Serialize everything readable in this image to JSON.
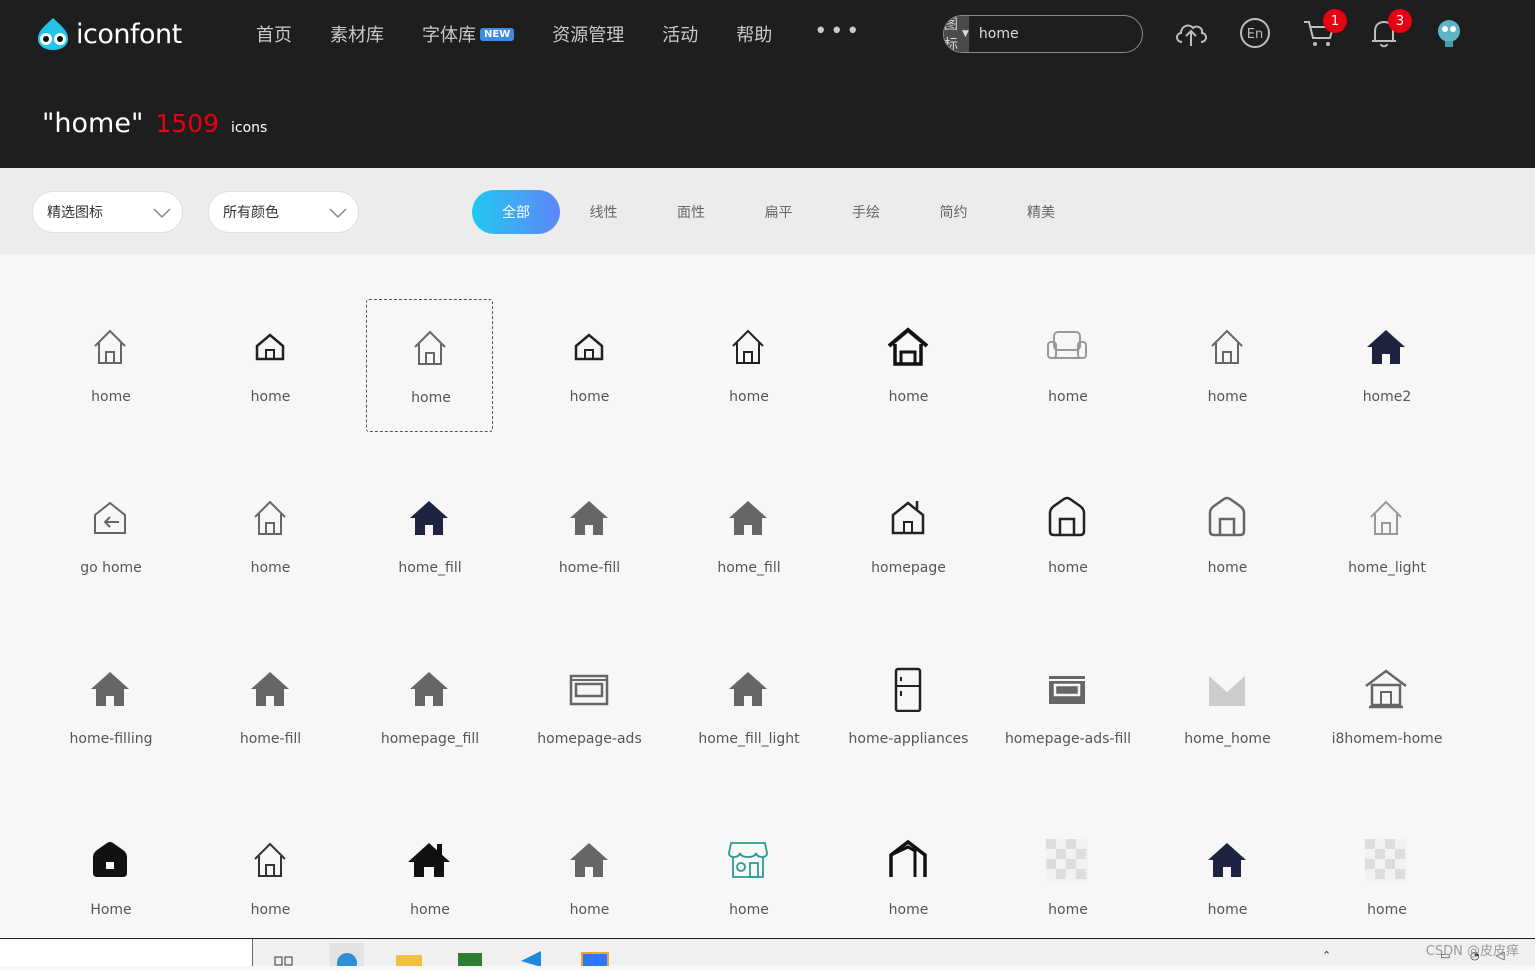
{
  "header": {
    "logo_text": "iconfont",
    "nav": [
      {
        "label": "首页"
      },
      {
        "label": "素材库"
      },
      {
        "label": "字体库",
        "badge": "NEW"
      },
      {
        "label": "资源管理"
      },
      {
        "label": "活动"
      },
      {
        "label": "帮助"
      }
    ],
    "more_label": "•••",
    "search": {
      "type_label": "图标",
      "value": "home"
    },
    "cart_count": "1",
    "notify_count": "3"
  },
  "result": {
    "query": "\"home\"",
    "count": "1509",
    "unit": "icons"
  },
  "filters": {
    "dropdown1": "精选图标",
    "dropdown2": "所有颜色",
    "tabs": [
      "全部",
      "线性",
      "面性",
      "扁平",
      "手绘",
      "简约",
      "精美"
    ],
    "active_tab": "全部"
  },
  "icons": [
    {
      "label": "home",
      "icon": "home-outline-icon",
      "color": "#666666"
    },
    {
      "label": "home",
      "icon": "home-small-outline-icon",
      "color": "#222222"
    },
    {
      "label": "home",
      "icon": "home-outline-icon",
      "color": "#666666"
    },
    {
      "label": "home",
      "icon": "home-small-outline-icon",
      "color": "#222222"
    },
    {
      "label": "home",
      "icon": "home-outline-icon",
      "color": "#222222"
    },
    {
      "label": "home",
      "icon": "home-bold-icon",
      "color": "#111111"
    },
    {
      "label": "home",
      "icon": "sofa-icon",
      "color": "#999999"
    },
    {
      "label": "home",
      "icon": "home-outline-icon",
      "color": "#666666"
    },
    {
      "label": "home2",
      "icon": "home-solid-icon",
      "color": "#1e2340"
    },
    {
      "label": "go home",
      "icon": "go-home-icon",
      "color": "#666666"
    },
    {
      "label": "home",
      "icon": "home-outline-icon",
      "color": "#666666"
    },
    {
      "label": "home_fill",
      "icon": "home-solid-icon",
      "color": "#1e2340"
    },
    {
      "label": "home-fill",
      "icon": "home-solid-icon",
      "color": "#666666"
    },
    {
      "label": "home_fill",
      "icon": "home-solid-icon",
      "color": "#666666"
    },
    {
      "label": "homepage",
      "icon": "homepage-icon",
      "color": "#222222"
    },
    {
      "label": "home",
      "icon": "home-rounded-icon",
      "color": "#222222"
    },
    {
      "label": "home",
      "icon": "home-rounded-icon",
      "color": "#666666"
    },
    {
      "label": "home_light",
      "icon": "home-outline-icon",
      "color": "#999999"
    },
    {
      "label": "home-filling",
      "icon": "home-solid-icon",
      "color": "#666666"
    },
    {
      "label": "home-fill",
      "icon": "home-solid-icon",
      "color": "#666666"
    },
    {
      "label": "homepage_fill",
      "icon": "home-solid-icon",
      "color": "#666666"
    },
    {
      "label": "homepage-ads",
      "icon": "ads-outline-icon",
      "color": "#666666"
    },
    {
      "label": "home_fill_light",
      "icon": "home-solid-icon",
      "color": "#666666"
    },
    {
      "label": "home-appliances",
      "icon": "fridge-icon",
      "color": "#222222"
    },
    {
      "label": "homepage-ads-fill",
      "icon": "ads-fill-icon",
      "color": "#666666"
    },
    {
      "label": "home_home",
      "icon": "mail-box-icon",
      "color": "#cccccc"
    },
    {
      "label": "i8homem-home",
      "icon": "temple-icon",
      "color": "#666666"
    },
    {
      "label": "Home",
      "icon": "home-blob-icon",
      "color": "#111111"
    },
    {
      "label": "home",
      "icon": "home-outline-icon",
      "color": "#333333"
    },
    {
      "label": "home",
      "icon": "home-chimney-icon",
      "color": "#111111"
    },
    {
      "label": "home",
      "icon": "home-solid-icon",
      "color": "#666666"
    },
    {
      "label": "home",
      "icon": "shop-icon",
      "color": "#2a9d8f"
    },
    {
      "label": "home",
      "icon": "home-corner-icon",
      "color": "#111111"
    },
    {
      "label": "home",
      "icon": "placeholder-icon",
      "color": "#dddddd"
    },
    {
      "label": "home",
      "icon": "home-solid-icon",
      "color": "#1e2340"
    },
    {
      "label": "home",
      "icon": "placeholder-icon",
      "color": "#dddddd"
    }
  ],
  "taskbar": {
    "watermark": "CSDN @皮皮痒"
  }
}
